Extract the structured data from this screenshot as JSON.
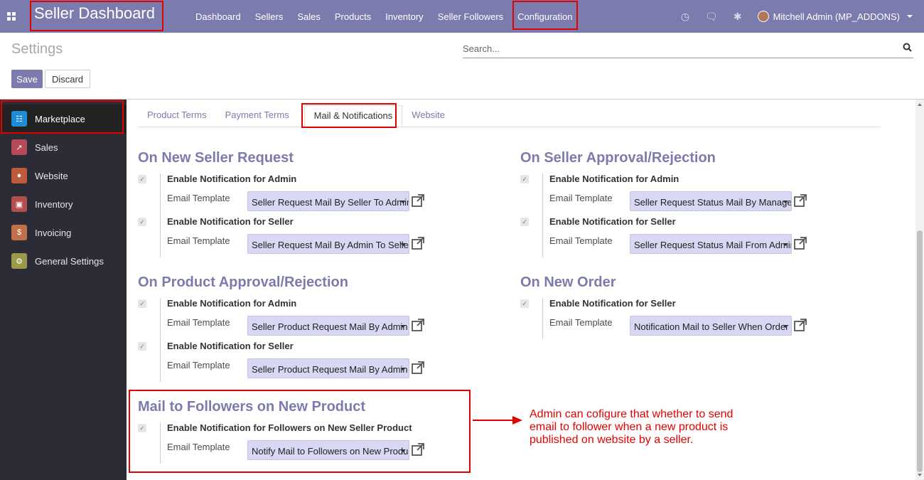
{
  "navbar": {
    "brand": "Seller Dashboard",
    "menu": [
      "Dashboard",
      "Sellers",
      "Sales",
      "Products",
      "Inventory",
      "Seller Followers",
      "Configuration"
    ],
    "user": "Mitchell Admin (MP_ADDONS)",
    "icons": [
      "apps-icon",
      "clock-icon",
      "chat-icon",
      "bug-icon"
    ]
  },
  "control_panel": {
    "title": "Settings",
    "search_placeholder": "Search...",
    "save_label": "Save",
    "discard_label": "Discard"
  },
  "sidebar": {
    "items": [
      {
        "label": "Marketplace",
        "color": "#1f8dd6"
      },
      {
        "label": "Sales",
        "color": "#b54b58"
      },
      {
        "label": "Website",
        "color": "#c05a3e"
      },
      {
        "label": "Inventory",
        "color": "#b24f4f"
      },
      {
        "label": "Invoicing",
        "color": "#c0704a"
      },
      {
        "label": "General Settings",
        "color": "#9a9a4a"
      }
    ]
  },
  "tabs": [
    "Product Terms",
    "Payment Terms",
    "Mail & Notifications",
    "Website"
  ],
  "active_tab": "Mail & Notifications",
  "sections": {
    "new_seller_request": {
      "title": "On New Seller Request",
      "admin_label": "Enable Notification for Admin",
      "admin_template_label": "Email Template",
      "admin_template": "Seller Request Mail By Seller To Admin",
      "seller_label": "Enable Notification for Seller",
      "seller_template_label": "Email Template",
      "seller_template": "Seller Request Mail By Admin To Seller"
    },
    "seller_approval": {
      "title": "On Seller Approval/Rejection",
      "admin_label": "Enable Notification for Admin",
      "admin_template_label": "Email Template",
      "admin_template": "Seller Request Status Mail By Manager",
      "seller_label": "Enable Notification for Seller",
      "seller_template_label": "Email Template",
      "seller_template": "Seller Request Status Mail From Admin"
    },
    "product_approval": {
      "title": "On Product Approval/Rejection",
      "admin_label": "Enable Notification for Admin",
      "admin_template_label": "Email Template",
      "admin_template": "Seller Product Request Mail By Admin",
      "seller_label": "Enable Notification for Seller",
      "seller_template_label": "Email Template",
      "seller_template": "Seller Product Request Mail By Admin"
    },
    "new_order": {
      "title": "On New Order",
      "seller_label": "Enable Notification for Seller",
      "seller_template_label": "Email Template",
      "seller_template": "Notification Mail to Seller When Order"
    },
    "followers": {
      "title": "Mail to Followers on New Product",
      "label": "Enable Notification for Followers on New Seller Product",
      "template_label": "Email Template",
      "template": "Notify Mail to Followers on New Product"
    }
  },
  "annotation": "Admin can cofigure that whether to send email to follower when a new product is published on website by a seller."
}
